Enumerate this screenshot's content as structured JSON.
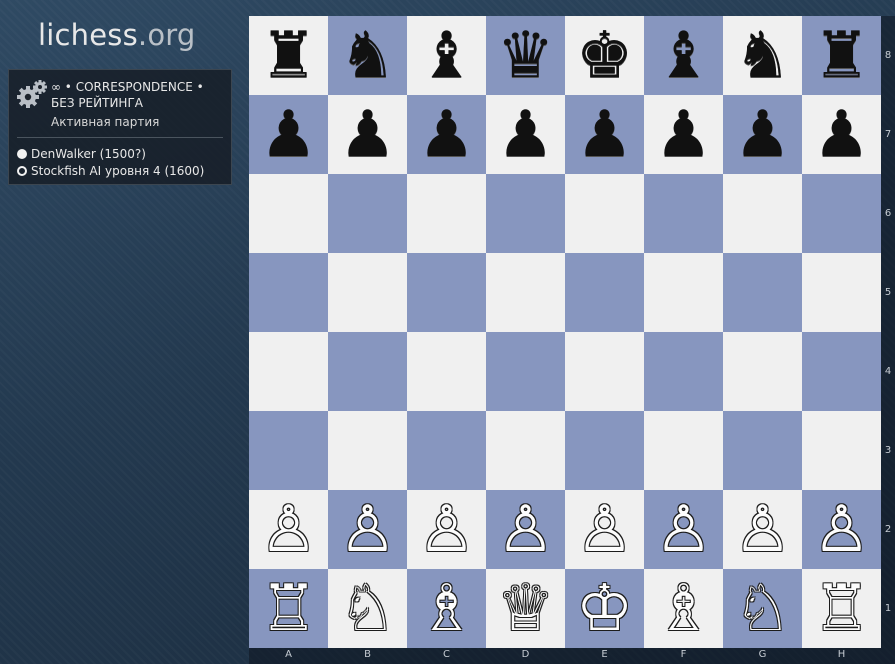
{
  "logo": {
    "name": "lichess",
    "tld": ".org"
  },
  "game_panel": {
    "icon": "gears-icon",
    "mode": "∞ • CORRESPONDENCE • БЕЗ РЕЙТИНГА",
    "status": "Активная партия",
    "players": [
      {
        "color": "white",
        "label": "DenWalker (1500?)"
      },
      {
        "color": "black",
        "label": "Stockfish AI уровня 4 (1600)"
      }
    ]
  },
  "board": {
    "light_color": "#f0f0f0",
    "dark_color": "#8796bf",
    "ranks": [
      "8",
      "7",
      "6",
      "5",
      "4",
      "3",
      "2",
      "1"
    ],
    "files": [
      "A",
      "B",
      "C",
      "D",
      "E",
      "F",
      "G",
      "H"
    ],
    "pieces": [
      [
        "♜",
        "♞",
        "♝",
        "♛",
        "♚",
        "♝",
        "♞",
        "♜"
      ],
      [
        "♟",
        "♟",
        "♟",
        "♟",
        "♟",
        "♟",
        "♟",
        "♟"
      ],
      [
        "",
        "",
        "",
        "",
        "",
        "",
        "",
        ""
      ],
      [
        "",
        "",
        "",
        "",
        "",
        "",
        "",
        ""
      ],
      [
        "",
        "",
        "",
        "",
        "",
        "",
        "",
        ""
      ],
      [
        "",
        "",
        "",
        "",
        "",
        "",
        "",
        ""
      ],
      [
        "♙",
        "♙",
        "♙",
        "♙",
        "♙",
        "♙",
        "♙",
        "♙"
      ],
      [
        "♖",
        "♘",
        "♗",
        "♕",
        "♔",
        "♗",
        "♘",
        "♖"
      ]
    ]
  }
}
